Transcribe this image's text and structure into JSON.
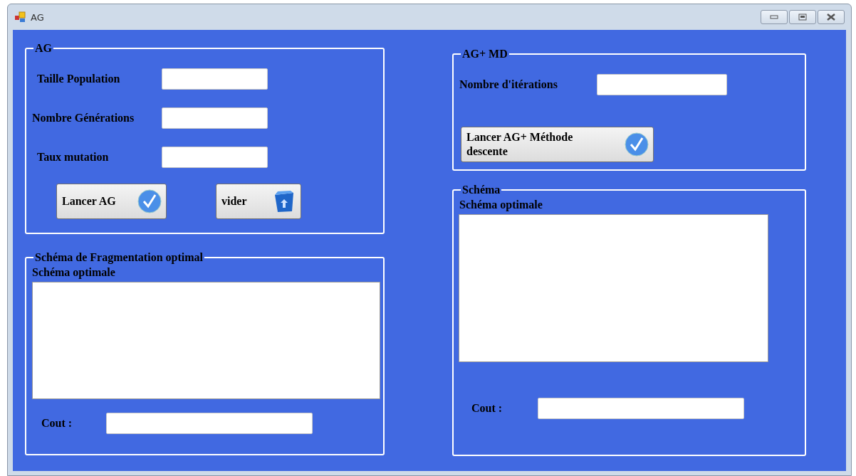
{
  "window": {
    "title": "AG"
  },
  "ag_group": {
    "title": "AG",
    "fields": [
      {
        "label": "Taille Population"
      },
      {
        "label": "Nombre Générations"
      },
      {
        "label": "Taux mutation"
      }
    ],
    "buttons": [
      {
        "label": "Lancer AG",
        "kind": "check"
      },
      {
        "label": "vider",
        "kind": "trash"
      }
    ]
  },
  "fragmentation_group": {
    "title": "Schéma de Fragmentation optimal",
    "schema_label": "Schéma optimale",
    "cost_label": "Cout :"
  },
  "agmd_group": {
    "title": "AG+ MD",
    "field_label": "Nombre d'itérations",
    "button": {
      "label": "Lancer AG+ Méthode descente",
      "kind": "check"
    }
  },
  "schema_group": {
    "title": "Schéma",
    "schema_label": "Schéma optimale",
    "cost_label": "Cout :"
  }
}
